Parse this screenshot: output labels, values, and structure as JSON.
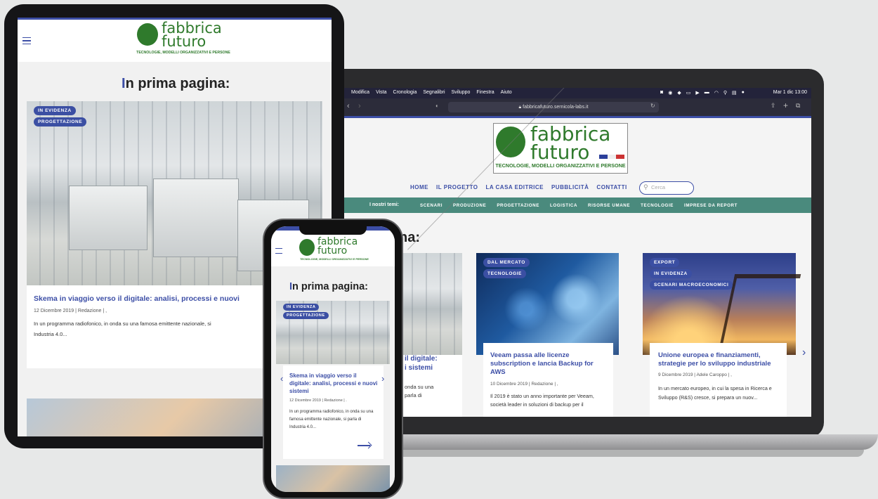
{
  "brand": {
    "name_line1": "fabbrica",
    "name_line2": "futuro",
    "tagline": "TECNOLOGIE, MODELLI ORGANIZZATIVI E PERSONE"
  },
  "mac_menubar": {
    "items": [
      "Modifica",
      "Vista",
      "Cronologia",
      "Segnalibri",
      "Sviluppo",
      "Finestra",
      "Aiuto"
    ],
    "clock": "Mar 1 dic  13:00"
  },
  "browser": {
    "url": "fabbricafuturo.sernicola-labs.it"
  },
  "site_nav": {
    "items": [
      "HOME",
      "IL PROGETTO",
      "LA CASA EDITRICE",
      "PUBBLICITÀ",
      "CONTATTI"
    ],
    "search_placeholder": "Cerca"
  },
  "topics_bar": {
    "label": "I nostri temi:",
    "items": [
      "SCENARI",
      "PRODUZIONE",
      "PROGETTAZIONE",
      "LOGISTICA",
      "RISORSE UMANE",
      "TECNOLOGIE",
      "IMPRESE DA REPORT"
    ]
  },
  "section": {
    "title_first": "I",
    "title_rest": "n prima pagina:",
    "title_cut": "na:"
  },
  "articles": [
    {
      "tags": [
        "IN EVIDENZA",
        "PROGETTAZIONE"
      ],
      "title": "Skema in viaggio verso il digitale: analisi, processi e nuovi sistemi",
      "title_cut_tablet": "Skema in viaggio verso il digitale: analisi, processi e nuovi",
      "title_cut_laptop1": "il digitale:",
      "title_cut_laptop2": "i sistemi",
      "date": "12 Dicembre 2019",
      "author": "Redazione",
      "excerpt": "In un programma radiofonico, in onda su una famosa emittente nazionale, si parla di Industria 4.0...",
      "excerpt_tablet_l1": "In un programma radiofonico, in onda su una famosa emittente nazionale, si",
      "excerpt_tablet_l2": "Industria 4.0...",
      "excerpt_laptop_l1": "onda su una",
      "excerpt_laptop_l2": "parla di"
    },
    {
      "tags": [
        "DAL MERCATO",
        "TECNOLOGIE"
      ],
      "title": "Veeam passa alle licenze subscription e lancia Backup for AWS",
      "date": "10 Dicembre 2019",
      "author": "Redazione",
      "excerpt": "Il 2019 è stato un anno importante per Veeam, società leader in soluzioni di backup per il"
    },
    {
      "tags": [
        "EXPORT",
        "IN EVIDENZA",
        "SCENARI MACROECONOMICI"
      ],
      "title": "Unione europea e finanziamenti, strategie per lo sviluppo industriale",
      "date": "9 Dicembre 2019",
      "author": "Adele Caroppo",
      "excerpt": "In un mercato europeo, in cui la spesa in Ricerca e Sviluppo (R&S) cresce, si prepara un nuov..."
    }
  ],
  "icons": {
    "hamburger": "hamburger-icon",
    "arrow_right": "arrow-right-icon",
    "chevron_left": "chevron-left-icon",
    "chevron_right": "chevron-right-icon"
  },
  "colors": {
    "brand_blue": "#3c4ea6",
    "brand_green": "#2f7a2c",
    "topics_bar": "#4a8a7d"
  }
}
